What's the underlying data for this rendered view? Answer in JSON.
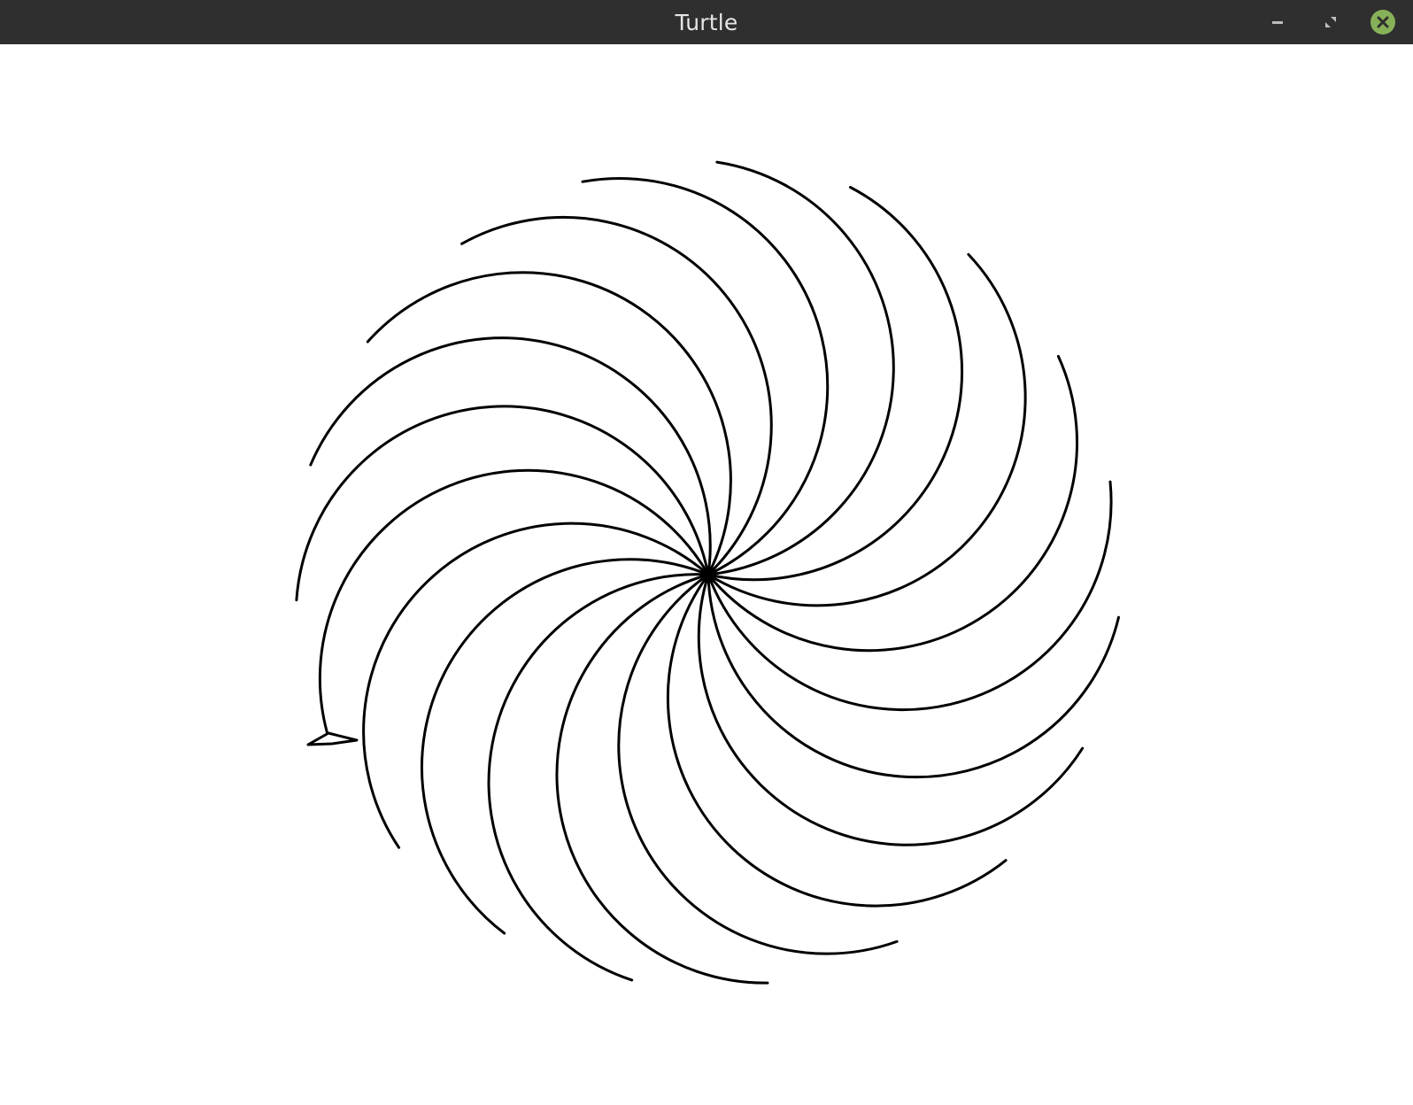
{
  "window": {
    "title": "Turtle"
  },
  "controls": {
    "minimize_icon": "minimize-icon",
    "maximize_icon": "maximize-icon",
    "close_icon": "close-icon",
    "close_color": "#87b158"
  },
  "drawing": {
    "arc_count": 19,
    "pen_color": "#000000",
    "background_color": "#ffffff",
    "turtle_icon": "turtle-arrow-icon"
  }
}
